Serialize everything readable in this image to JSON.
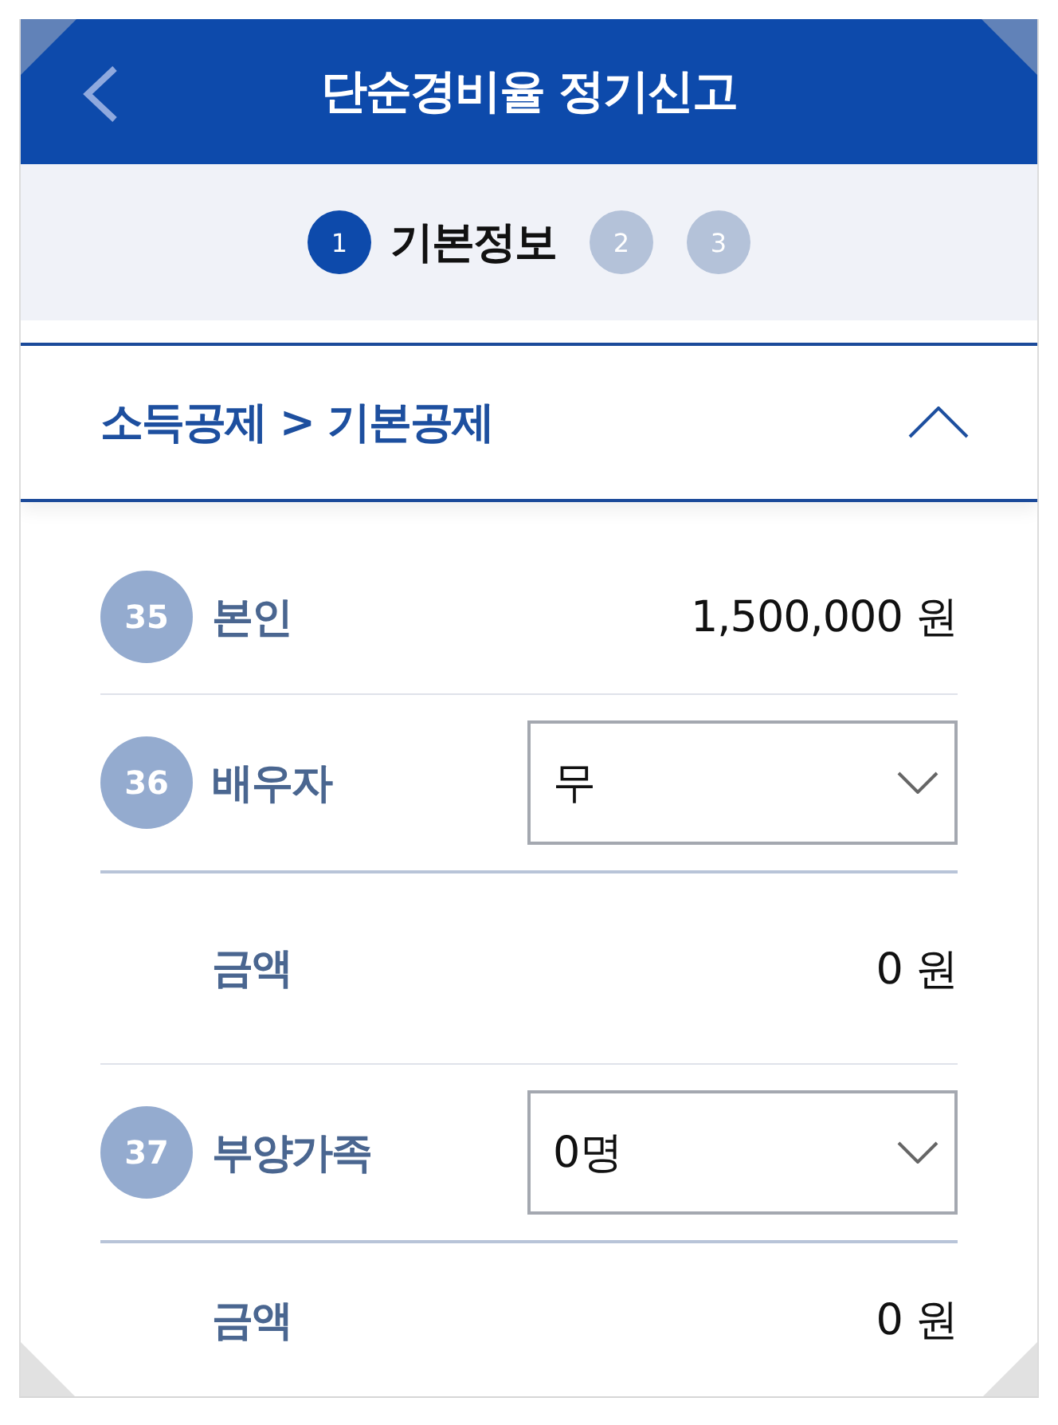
{
  "header": {
    "title": "단순경비율 정기신고"
  },
  "steps": [
    {
      "number": "1",
      "label": "기본정보",
      "selected": true
    },
    {
      "number": "2",
      "selected": false
    },
    {
      "number": "3",
      "selected": false
    }
  ],
  "section": {
    "title": "소득공제 > 기본공제",
    "expanded": true
  },
  "rows": [
    {
      "kind": "value",
      "number": "35",
      "label": "본인",
      "value": "1,500,000 원"
    },
    {
      "kind": "select",
      "number": "36",
      "label": "배우자",
      "value": "무"
    },
    {
      "kind": "amount",
      "label": "금액",
      "value": "0 원"
    },
    {
      "kind": "select",
      "number": "37",
      "label": "부양가족",
      "value": "0명"
    },
    {
      "kind": "amount",
      "label": "금액",
      "value": "0 원"
    }
  ]
}
